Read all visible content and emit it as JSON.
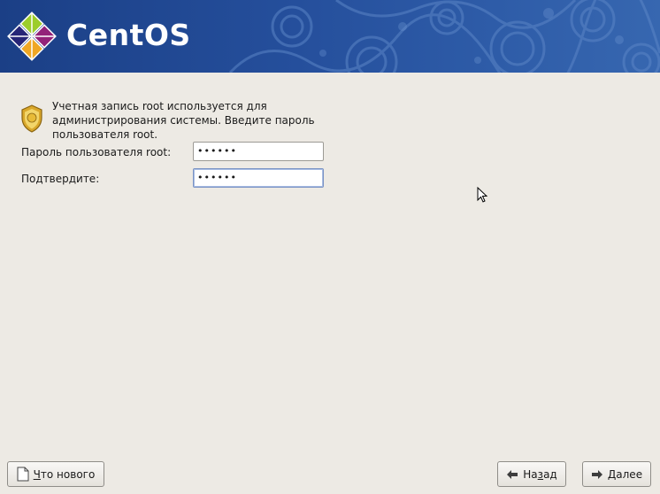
{
  "header": {
    "brand": "CentOS",
    "icon": "centos-logo"
  },
  "intro": {
    "icon": "security-badge-icon",
    "text": "Учетная запись root используется для\nадминистрирования системы. Введите пароль\nпользователя root."
  },
  "form": {
    "password_label": "Пароль пользователя root:",
    "password_value": "••••••",
    "confirm_label": "Подтвердите:",
    "confirm_value": "••••••"
  },
  "buttons": {
    "release_notes": {
      "mnemonic": "Ч",
      "rest": "то нового",
      "icon": "document-icon"
    },
    "back": {
      "pre": "На",
      "mnemonic": "з",
      "rest": "ад",
      "icon": "arrow-left-icon"
    },
    "next": {
      "mnemonic": "Д",
      "rest": "алее",
      "icon": "arrow-right-icon"
    }
  },
  "colors": {
    "header_bg": "#254f9c",
    "window_bg": "#edeae4",
    "focus_border": "#7a93c4"
  }
}
